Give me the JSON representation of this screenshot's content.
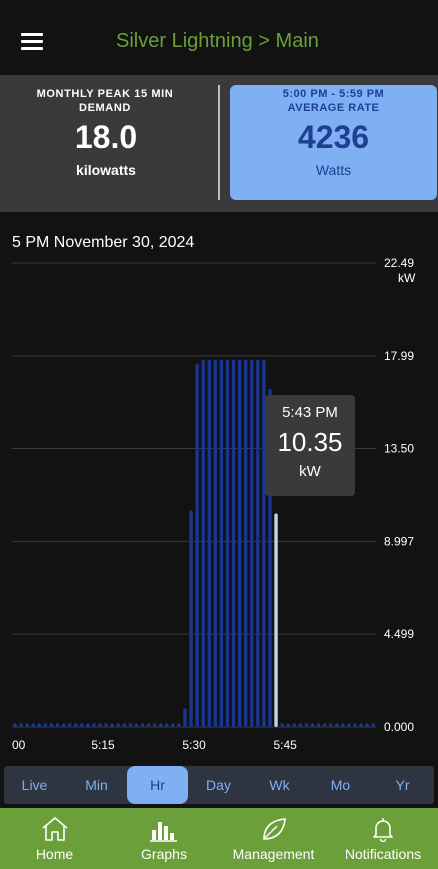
{
  "header": {
    "menu_icon": "hamburger-icon",
    "title": "Silver Lightning > Main"
  },
  "summary": {
    "peak_label": "MONTHLY PEAK 15 MIN DEMAND",
    "peak_value": "18.0",
    "peak_unit": "kilowatts",
    "rate_time": "5:00 PM - 5:59 PM",
    "rate_label": "AVERAGE RATE",
    "rate_value": "4236",
    "rate_unit": "Watts"
  },
  "chart_date": "5 PM November 30, 2024",
  "tooltip": {
    "time": "5:43 PM",
    "value": "10.35",
    "unit": "kW"
  },
  "chart_data": {
    "type": "bar",
    "title": "",
    "xlabel": "",
    "ylabel": "",
    "y_unit": "kW",
    "ylim": [
      0,
      22.49
    ],
    "y_ticks": [
      "22.49",
      "17.99",
      "13.50",
      "8.997",
      "4.499",
      "0.000"
    ],
    "y_tick_values": [
      22.49,
      17.99,
      13.5,
      8.997,
      4.499,
      0.0
    ],
    "x_tick_labels": [
      "00",
      "5:15",
      "5:30",
      "5:45"
    ],
    "x_tick_minutes": [
      0,
      15,
      30,
      45
    ],
    "x_range_minutes": [
      0,
      60
    ],
    "grid": true,
    "bar_color": "#1a3590",
    "highlight_color": "#c5d3f3",
    "highlight_index": 43,
    "series": [
      {
        "values": [
          0.18,
          0.18,
          0.18,
          0.18,
          0.18,
          0.18,
          0.18,
          0.18,
          0.18,
          0.18,
          0.18,
          0.18,
          0.18,
          0.18,
          0.18,
          0.18,
          0.18,
          0.18,
          0.18,
          0.18,
          0.18,
          0.18,
          0.18,
          0.18,
          0.18,
          0.18,
          0.18,
          0.18,
          0.9,
          10.5,
          17.6,
          17.8,
          17.8,
          17.8,
          17.8,
          17.8,
          17.8,
          17.8,
          17.8,
          17.8,
          17.8,
          17.8,
          16.4,
          10.35,
          0.18,
          0.18,
          0.18,
          0.18,
          0.18,
          0.18,
          0.18,
          0.18,
          0.18,
          0.18,
          0.18,
          0.18,
          0.18,
          0.18,
          0.18,
          0.18
        ]
      }
    ]
  },
  "ranges": [
    {
      "label": "Live",
      "active": false
    },
    {
      "label": "Min",
      "active": false
    },
    {
      "label": "Hr",
      "active": true
    },
    {
      "label": "Day",
      "active": false
    },
    {
      "label": "Wk",
      "active": false
    },
    {
      "label": "Mo",
      "active": false
    },
    {
      "label": "Yr",
      "active": false
    }
  ],
  "nav": [
    {
      "label": "Home",
      "icon": "home-icon"
    },
    {
      "label": "Graphs",
      "icon": "bar-chart-icon"
    },
    {
      "label": "Management",
      "icon": "leaf-icon"
    },
    {
      "label": "Notifications",
      "icon": "bell-icon"
    }
  ]
}
